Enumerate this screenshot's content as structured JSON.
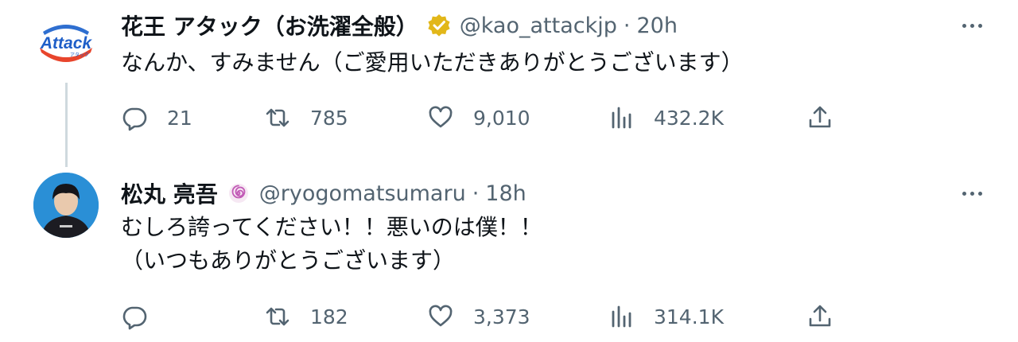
{
  "tweets": [
    {
      "name": "花王 アタック（お洗濯全般）",
      "handle": "@kao_attackjp",
      "separator": "·",
      "time": "20h",
      "verified_badge_color": "#e2b719",
      "avatar_logo_text": "Attack",
      "lines": [
        "なんか、すみません（ご愛用いただきありがとうございます）"
      ],
      "replies": "21",
      "retweets": "785",
      "likes": "9,010",
      "views": "432.2K"
    },
    {
      "name": "松丸 亮吾",
      "handle": "@ryogomatsumaru",
      "separator": "·",
      "time": "18h",
      "lines": [
        "むしろ誇ってください！！悪いのは僕！！",
        "（いつもありがとうございます）"
      ],
      "replies": "",
      "retweets": "182",
      "likes": "3,373",
      "views": "314.1K"
    }
  ],
  "icons": {
    "more": "more-horizontal-icon",
    "reply": "reply-bubble-icon",
    "retweet": "retweet-icon",
    "like": "heart-icon",
    "views": "analytics-bars-icon",
    "share": "share-upload-icon",
    "verified": "gold-verified-badge-icon",
    "name_badge": "spiral-emoji-icon"
  },
  "colors": {
    "text": "#0f1419",
    "secondary": "#536471",
    "connector": "#cfd9de",
    "verified": "#e2b719"
  }
}
